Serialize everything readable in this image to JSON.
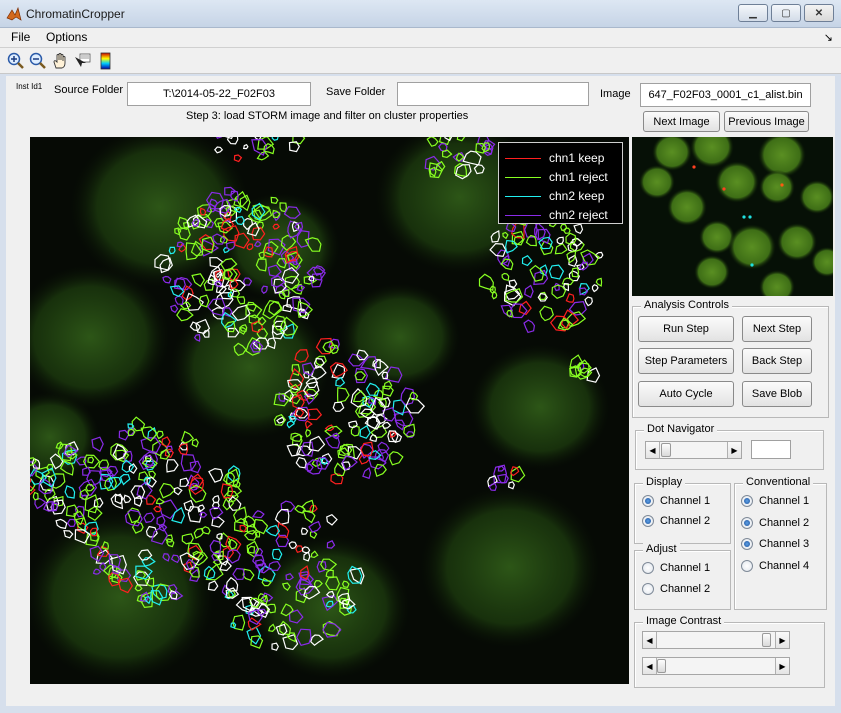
{
  "window": {
    "title": "ChromatinCropper"
  },
  "menu": {
    "file": "File",
    "options": "Options",
    "arrow": "↘"
  },
  "toolbar": {
    "icons": [
      "zoom-in-icon",
      "zoom-out-icon",
      "pan-hand-icon",
      "data-cursor-icon",
      "colorbar-icon"
    ]
  },
  "top": {
    "inst_id": "Inst Id1",
    "source_label": "Source Folder",
    "source_value": "T:\\2014-05-22_F02F03",
    "save_label": "Save Folder",
    "save_value": "",
    "image_label": "Image",
    "image_value": "647_F02F03_0001_c1_alist.bin",
    "step_text": "Step 3: load STORM image and filter on cluster properties",
    "next_image": "Next Image",
    "previous_image": "Previous Image"
  },
  "legend": {
    "items": [
      {
        "label": "chn1 keep",
        "color": "#ff2020"
      },
      {
        "label": "chn1 reject",
        "color": "#88ff22"
      },
      {
        "label": "chn2 keep",
        "color": "#22f0f0"
      },
      {
        "label": "chn2 reject",
        "color": "#8a2be8"
      }
    ]
  },
  "analysis": {
    "title": "Analysis Controls",
    "run_step": "Run Step",
    "next_step": "Next Step",
    "step_parameters": "Step Parameters",
    "back_step": "Back Step",
    "auto_cycle": "Auto Cycle",
    "save_blob": "Save Blob"
  },
  "dot_navigator": {
    "title": "Dot Navigator",
    "value": ""
  },
  "display": {
    "title": "Display",
    "channels": [
      {
        "label": "Channel 1",
        "selected": true
      },
      {
        "label": "Channel 2",
        "selected": true
      }
    ]
  },
  "adjust": {
    "title": "Adjust",
    "channels": [
      {
        "label": "Channel 1",
        "selected": false
      },
      {
        "label": "Channel 2",
        "selected": false
      }
    ]
  },
  "conventional": {
    "title": "Conventional",
    "channels": [
      {
        "label": "Channel 1",
        "selected": true
      },
      {
        "label": "Channel 2",
        "selected": true
      },
      {
        "label": "Channel 3",
        "selected": true
      },
      {
        "label": "Channel 4",
        "selected": false
      }
    ]
  },
  "contrast": {
    "title": "Image Contrast",
    "upper": 0.95,
    "lower": 0.0
  },
  "colors": {
    "chn1_keep": "#ff2020",
    "chn1_reject": "#88ff22",
    "chn2_keep": "#22f0f0",
    "chn2_reject": "#8a2be8",
    "chn2_white": "#ffffff"
  }
}
